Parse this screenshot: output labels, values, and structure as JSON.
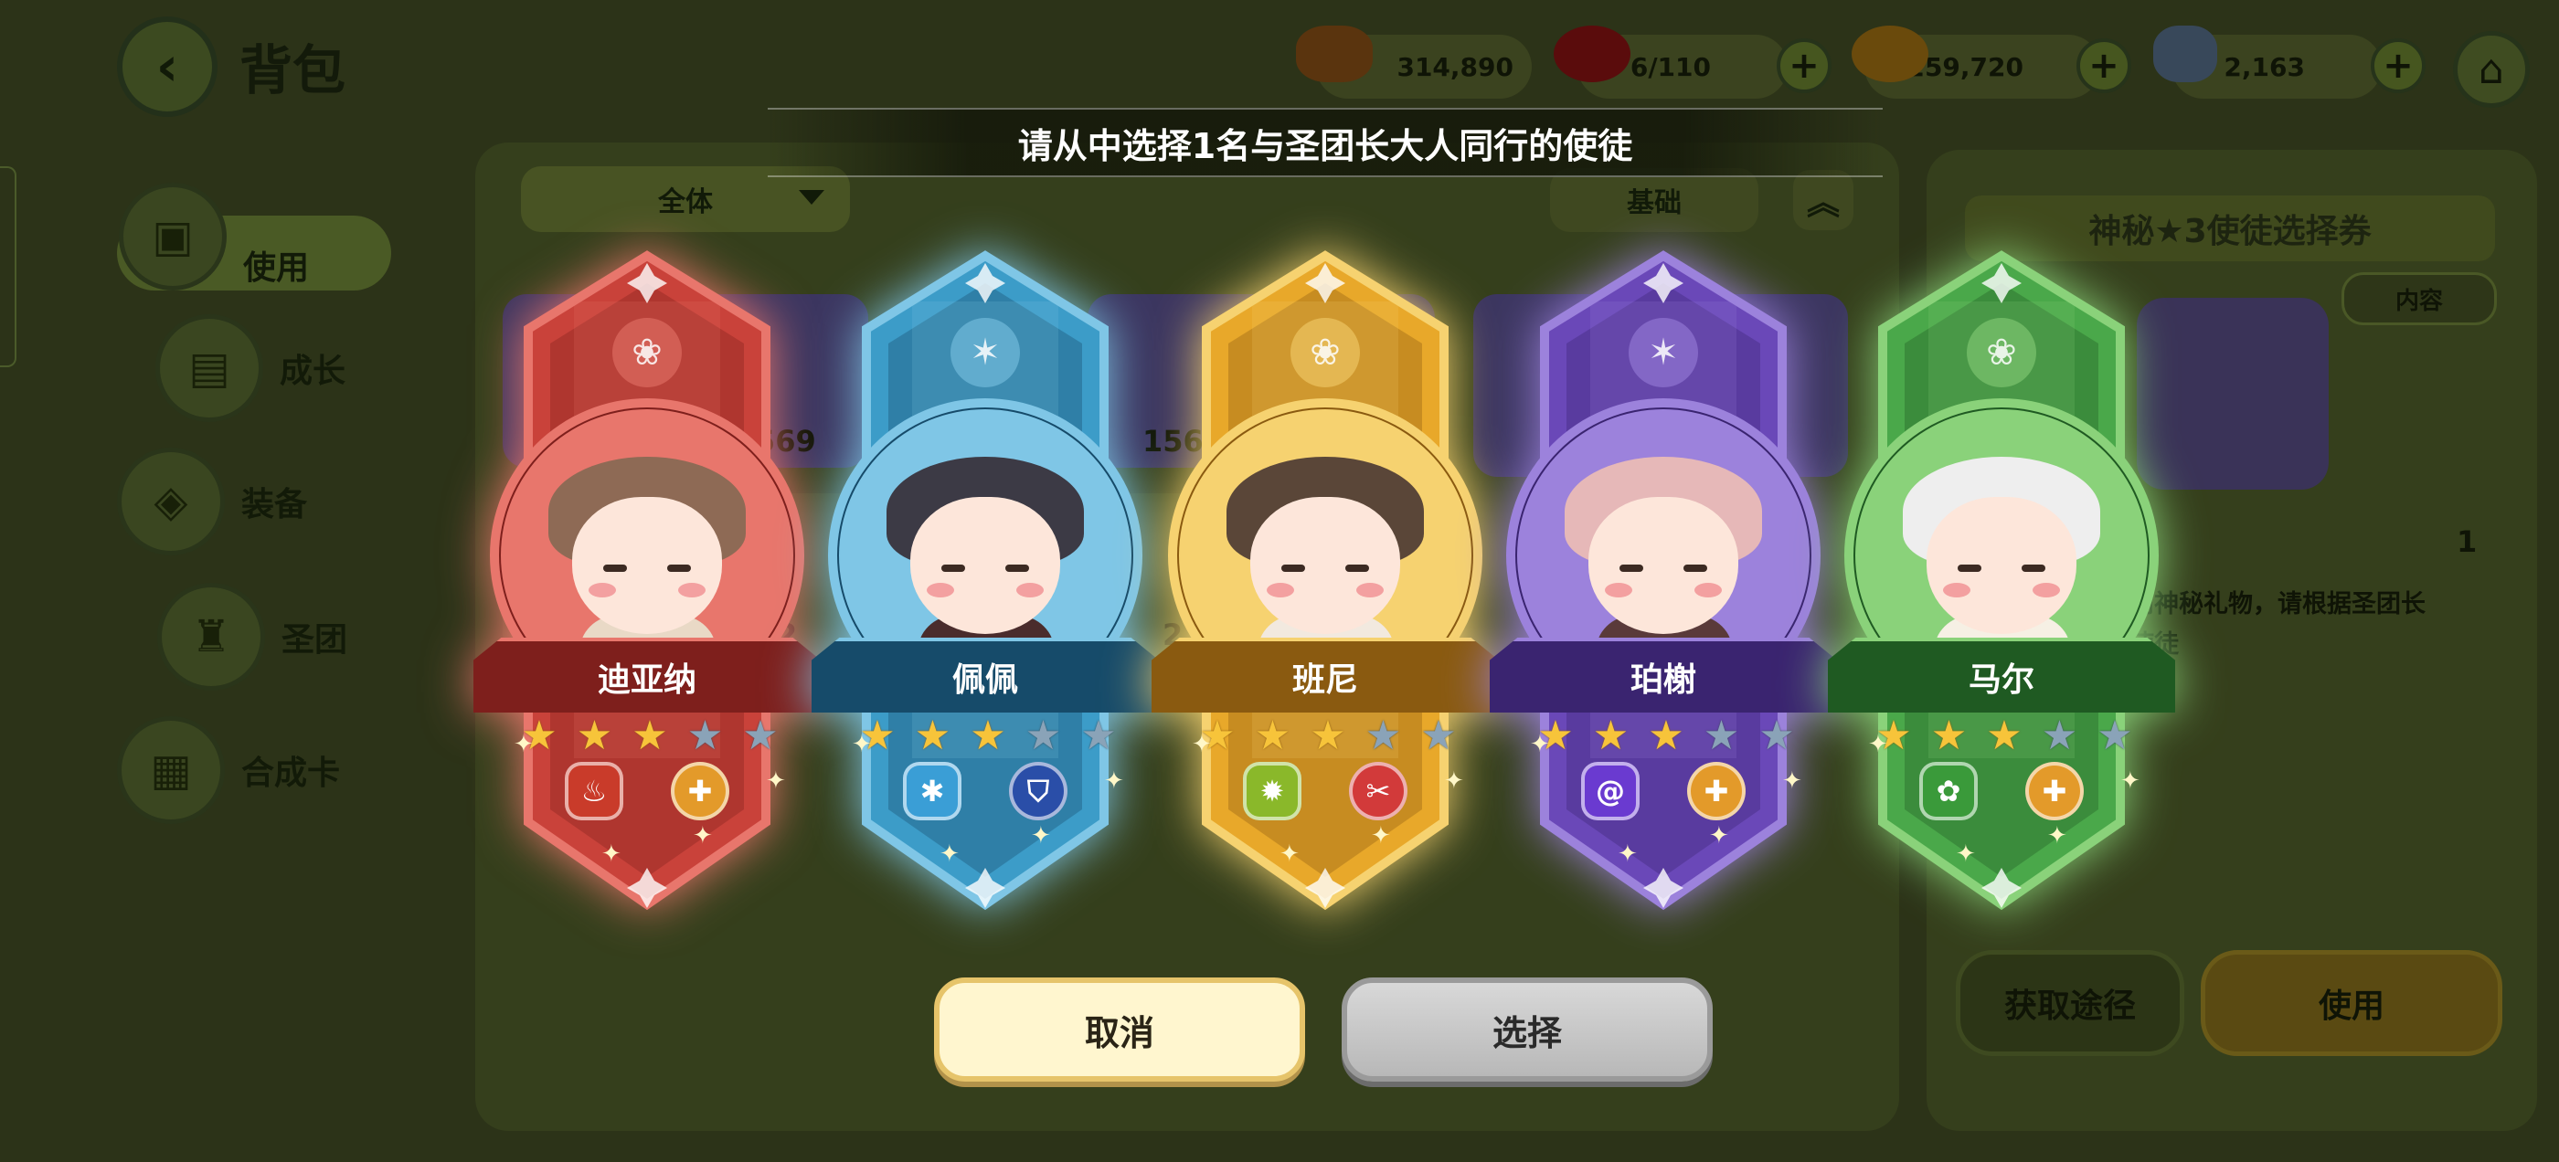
{
  "header": {
    "back_icon": "chevron-left-icon",
    "title": "背包",
    "home_icon": "home-icon",
    "currencies": [
      {
        "icon": "coin-stack-icon",
        "color": "#8a4d12",
        "value": "314,890",
        "has_plus": false
      },
      {
        "icon": "red-gem-icon",
        "color": "#8a1010",
        "value": "6/110",
        "has_plus": true
      },
      {
        "icon": "gold-coin-icon",
        "color": "#b07a10",
        "value": "1,259,720",
        "has_plus": true
      },
      {
        "icon": "butterfly-icon",
        "color": "#5a7aa0",
        "value": "2,163",
        "has_plus": true
      }
    ]
  },
  "sidebar": {
    "items": [
      {
        "label": "使用",
        "icon": "chest-icon",
        "active": true
      },
      {
        "label": "成长",
        "icon": "book-icon",
        "active": false
      },
      {
        "label": "装备",
        "icon": "armor-icon",
        "active": false
      },
      {
        "label": "圣团",
        "icon": "castle-icon",
        "active": false
      },
      {
        "label": "合成卡",
        "icon": "card-icon",
        "active": false
      }
    ]
  },
  "inventory": {
    "filter_label": "全体",
    "sort_label": "基础",
    "counts": [
      "569",
      "156",
      "2",
      "2"
    ]
  },
  "detail": {
    "title": "神秘★3使徒选择券",
    "content_button": "内容",
    "quantity": "1",
    "description_line1": "内神秘礼物，请根据圣团长",
    "description_line2": "使徒",
    "source_button": "获取途径",
    "use_button": "使用"
  },
  "modal": {
    "title": "请从中选择1名与圣团长大人同行的使徒",
    "cancel_label": "取消",
    "select_label": "选择",
    "characters": [
      {
        "name": "迪亚纳",
        "stars": 3,
        "max_stars": 5,
        "theme": "#c9423a",
        "dark": "#7e1f1c",
        "light": "#e8766c",
        "emblem": "paw-icon",
        "hair": "#8e6a55",
        "outfit": "#e9d9c6",
        "badges": [
          {
            "icon": "fire-icon",
            "color": "#c93b2a",
            "shape": "hex"
          },
          {
            "icon": "cross-icon",
            "color": "#e39a2a",
            "shape": "circle"
          }
        ]
      },
      {
        "name": "佩佩",
        "stars": 3,
        "max_stars": 5,
        "theme": "#3c9cc8",
        "dark": "#164b6a",
        "light": "#7fc6e6",
        "emblem": "star-burst-icon",
        "hair": "#3c3a45",
        "outfit": "#4a2c2c",
        "badges": [
          {
            "icon": "snowflake-icon",
            "color": "#3a9ed6",
            "shape": "hex"
          },
          {
            "icon": "shield-icon",
            "color": "#2a4ea8",
            "shape": "circle"
          }
        ]
      },
      {
        "name": "班尼",
        "stars": 3,
        "max_stars": 5,
        "theme": "#e8a82a",
        "dark": "#8a5a10",
        "light": "#f6d270",
        "emblem": "paw-icon",
        "hair": "#5a4638",
        "outfit": "#f2e9df",
        "badges": [
          {
            "icon": "sun-icon",
            "color": "#8ab82a",
            "shape": "hex"
          },
          {
            "icon": "sword-icon",
            "color": "#d23a3a",
            "shape": "circle"
          }
        ]
      },
      {
        "name": "珀榭",
        "stars": 3,
        "max_stars": 5,
        "theme": "#6a48b8",
        "dark": "#3a2470",
        "light": "#9c82dc",
        "emblem": "star-burst-icon",
        "hair": "#e6b8b8",
        "outfit": "#5a3a3a",
        "badges": [
          {
            "icon": "spiral-icon",
            "color": "#6a3ad0",
            "shape": "hex"
          },
          {
            "icon": "cross-icon",
            "color": "#e39a2a",
            "shape": "circle"
          }
        ]
      },
      {
        "name": "马尔",
        "stars": 3,
        "max_stars": 5,
        "theme": "#4aa84a",
        "dark": "#1f5a22",
        "light": "#8ad27a",
        "emblem": "paw-icon",
        "hair": "#eeeeee",
        "outfit": "#f6f0e4",
        "badges": [
          {
            "icon": "clover-icon",
            "color": "#3a9a3a",
            "shape": "hex"
          },
          {
            "icon": "cross-icon",
            "color": "#e39a2a",
            "shape": "circle"
          }
        ]
      }
    ]
  }
}
